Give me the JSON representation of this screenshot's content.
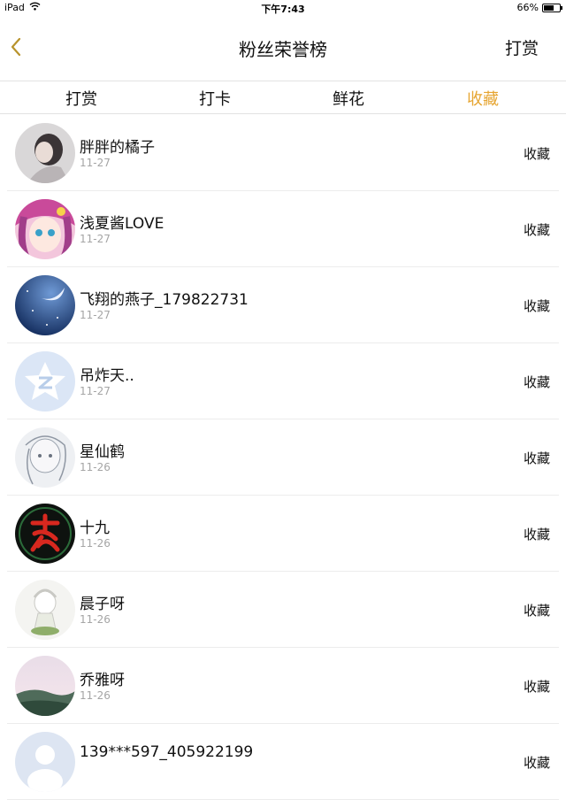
{
  "status_bar": {
    "device": "iPad",
    "time": "下午7:43",
    "battery": "66%",
    "battery_level": 0.66
  },
  "nav": {
    "title": "粉丝荣誉榜",
    "right_button": "打赏"
  },
  "tabs": [
    {
      "label": "打赏",
      "active": false
    },
    {
      "label": "打卡",
      "active": false
    },
    {
      "label": "鲜花",
      "active": false
    },
    {
      "label": "收藏",
      "active": true
    }
  ],
  "colors": {
    "accent": "#e6a531",
    "text": "#111111",
    "muted": "#a5a5a5",
    "divider": "#ececec"
  },
  "list": [
    {
      "name": "胖胖的橘子",
      "date": "11-27",
      "action": "收藏",
      "avatar": "girl-photo-avatar"
    },
    {
      "name": "浅夏酱LOVE",
      "date": "11-27",
      "action": "收藏",
      "avatar": "anime-girl-avatar"
    },
    {
      "name": "飞翔的燕子_179822731",
      "date": "11-27",
      "action": "收藏",
      "avatar": "night-sky-avatar"
    },
    {
      "name": "吊炸天..",
      "date": "11-27",
      "action": "收藏",
      "avatar": "qq-default-avatar"
    },
    {
      "name": "星仙鹤",
      "date": "11-26",
      "action": "收藏",
      "avatar": "sketch-avatar"
    },
    {
      "name": "十九",
      "date": "11-26",
      "action": "收藏",
      "avatar": "calligraphy-avatar"
    },
    {
      "name": "晨子呀",
      "date": "11-26",
      "action": "收藏",
      "avatar": "chibi-avatar"
    },
    {
      "name": "乔雅呀",
      "date": "11-26",
      "action": "收藏",
      "avatar": "landscape-avatar"
    },
    {
      "name": "139***597_405922199",
      "date": "",
      "action": "收藏",
      "avatar": "default-avatar"
    }
  ]
}
